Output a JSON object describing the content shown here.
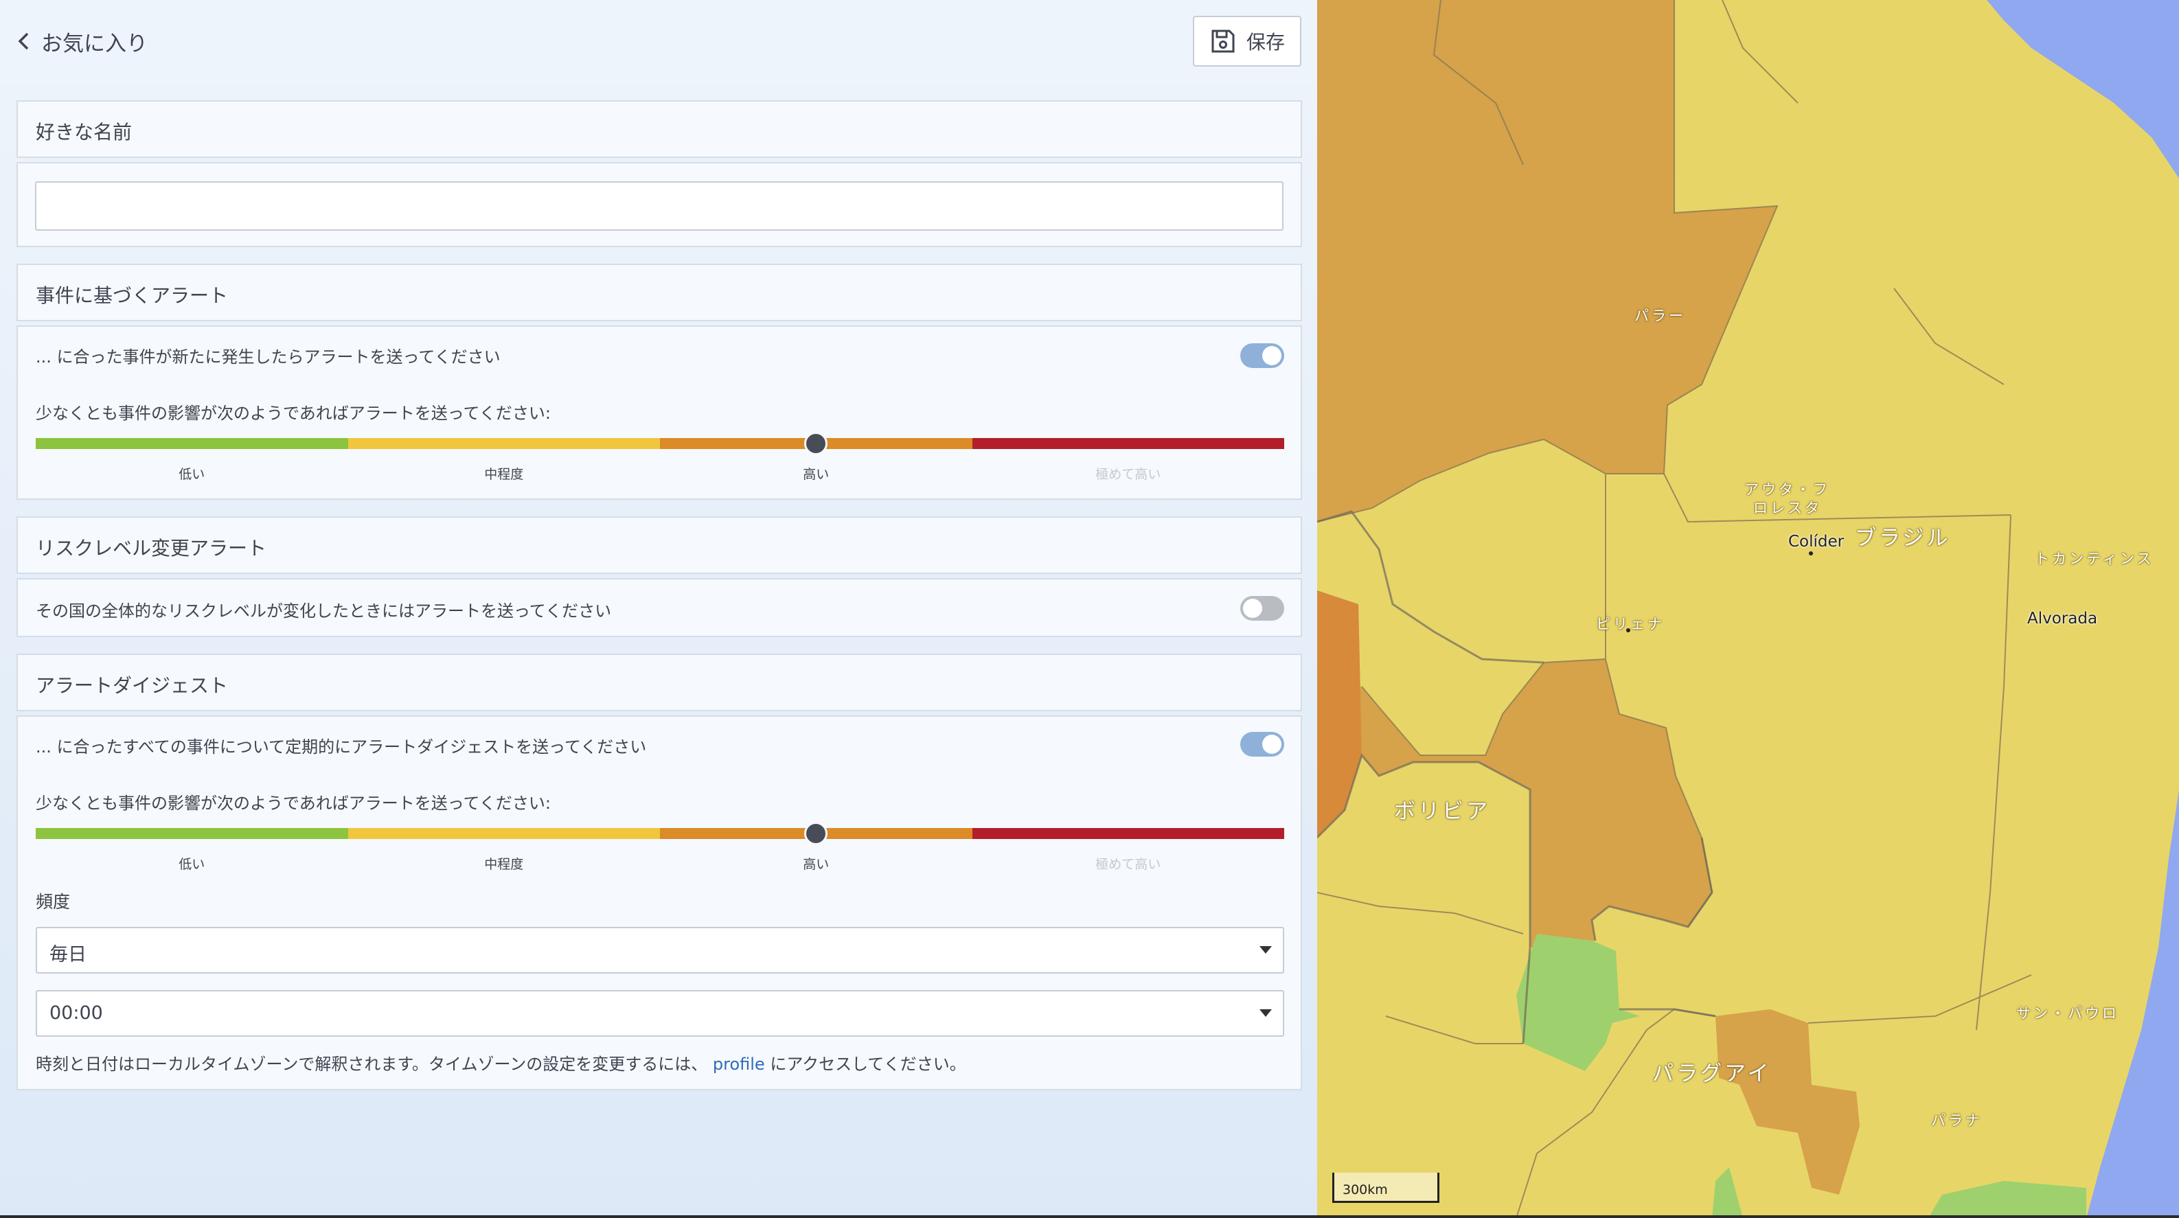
{
  "header": {
    "back_label": "お気に入り",
    "save_label": "保存"
  },
  "name_section": {
    "title": "好きな名前",
    "input_value": ""
  },
  "event_alerts": {
    "title": "事件に基づくアラート",
    "toggle_text": "... に合った事件が新たに発生したらアラートを送ってください",
    "toggle_on": true,
    "impact_text": "少なくとも事件の影響が次のようであればアラートを送ってください:",
    "levels": [
      "低い",
      "中程度",
      "高い",
      "極めて高い"
    ],
    "selected_level": "高い"
  },
  "risk_alerts": {
    "title": "リスクレベル変更アラート",
    "toggle_text": "その国の全体的なリスクレベルが変化したときにはアラートを送ってください",
    "toggle_on": false
  },
  "digest": {
    "title": "アラートダイジェスト",
    "toggle_text": "... に合ったすべての事件について定期的にアラートダイジェストを送ってください",
    "toggle_on": true,
    "impact_text": "少なくとも事件の影響が次のようであればアラートを送ってください:",
    "levels": [
      "低い",
      "中程度",
      "高い",
      "極めて高い"
    ],
    "selected_level": "高い",
    "frequency_label": "頻度",
    "frequency_value": "毎日",
    "time_value": "00:00",
    "note_before": "時刻と日付はローカルタイムゾーンで解釈されます。タイムゾーンの設定を変更するには、",
    "note_link": "profile",
    "note_after": "にアクセスしてください。"
  },
  "colors": {
    "low": "#8dc43f",
    "medium": "#f0c63c",
    "high": "#db8b27",
    "extreme": "#b31e2b",
    "map_low": "#9fd06e",
    "map_medium": "#e6d468",
    "map_high": "#d6a24a",
    "water": "#8fa8ef"
  },
  "map": {
    "labels": {
      "brazil": "ブラジル",
      "bolivia": "ボリビア",
      "paraguay": "パラグアイ",
      "para": "パラー",
      "tocantins": "トカンティンス",
      "sao_paulo": "サン・パウロ",
      "parana": "パラナ",
      "pirena": "ピリェナ",
      "alta_floresta_1": "アウタ・フ",
      "alta_floresta_2": "ロレスタ",
      "colider": "Colíder",
      "alvorada": "Alvorada"
    },
    "scale_label": "300km"
  }
}
